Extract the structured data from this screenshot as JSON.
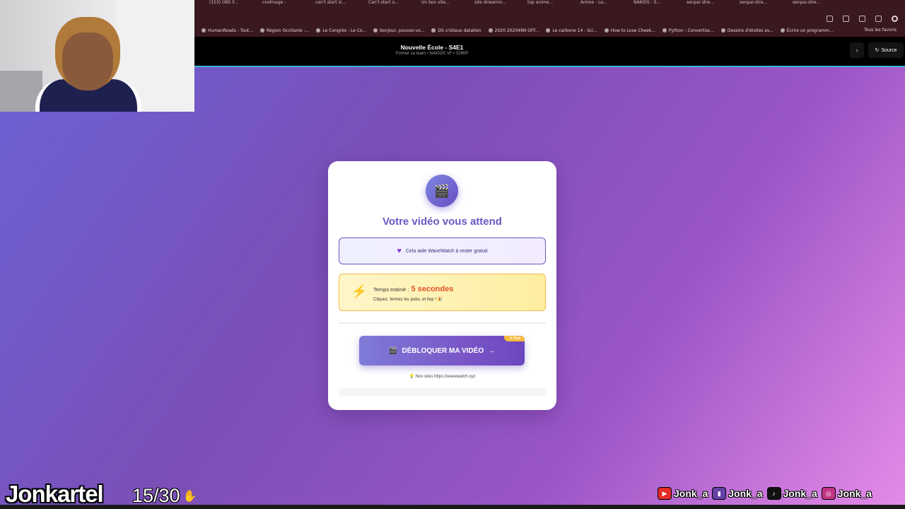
{
  "browser": {
    "tabs": [
      "(153) OBS F...",
      "coolmage -",
      "can't start si...",
      "Can't start o...",
      "Un bon site...",
      "site streamin...",
      "top anime...",
      "Anime - Le...",
      "NAKIOS - S...",
      "senpai stre...",
      "senpai-stre...",
      "senpai-stre..."
    ],
    "bookmarks": [
      "HumanRoads - Tout...",
      "Région Occitanie -...",
      "Le Congrès - Le Co...",
      "bonjour, pouvez-vo...",
      "DS cristaux datation",
      "2020 202049N OFF...",
      "Le carbone 14 - Sci...",
      "How to Lose Cheek...",
      "Python : Convertiss...",
      "Dessins d'étoiles av...",
      "Écrire un programm..."
    ],
    "bookmarks_right": "Tous les favoris"
  },
  "header": {
    "title": "Nouvelle École - S4E1",
    "subtitle": "Former sa team • NAKIOS VF • 1080P",
    "source_label": "Source"
  },
  "modal": {
    "title": "Votre vidéo vous attend",
    "support_text": "Cela aide WaveWatch à rester gratuit",
    "time_label": "Temps estimé :",
    "time_value": "5 secondes",
    "time_hint": "Cliquez, fermez les pubs, et hop ! 🎉",
    "unlock_label": "DÉBLOQUER MA VIDÉO",
    "ad_tag": "+1 Pub",
    "site_note": "Nos sites https://wavewatch.xyz"
  },
  "overlay": {
    "streamer": "Jonkartel",
    "sub_count": "15/30",
    "socials": [
      {
        "platform": "youtube",
        "icon": "youtube-icon",
        "handle": "Jonk_a",
        "color": "#e52d27"
      },
      {
        "platform": "twitch",
        "icon": "twitch-icon",
        "handle": "Jonk_a",
        "color": "#6441a5"
      },
      {
        "platform": "tiktok",
        "icon": "tiktok-icon",
        "handle": "Jonk_a",
        "color": "#111111"
      },
      {
        "platform": "instagram",
        "icon": "instagram-icon",
        "handle": "Jonk_a",
        "color": "#c13584"
      }
    ]
  },
  "colors": {
    "accent": "#6c56c2",
    "warning": "#e0542a"
  }
}
